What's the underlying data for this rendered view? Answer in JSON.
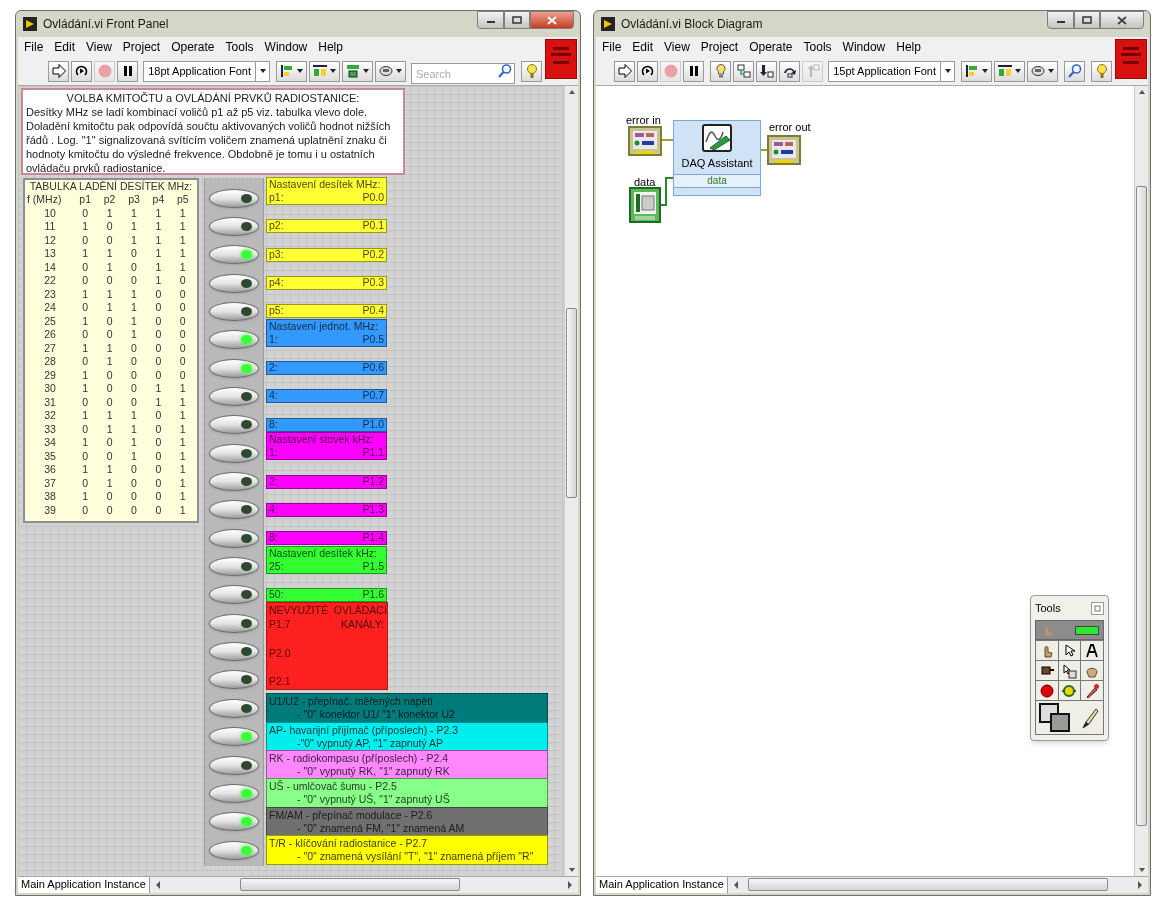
{
  "front_panel": {
    "title": "Ovládání.vi Front Panel",
    "active": true,
    "menu": [
      "File",
      "Edit",
      "View",
      "Project",
      "Operate",
      "Tools",
      "Window",
      "Help"
    ],
    "toolbar": [
      {
        "kind": "run",
        "disabled": false
      },
      {
        "kind": "run_continuous",
        "disabled": false
      },
      {
        "kind": "abort",
        "disabled": true
      },
      {
        "kind": "pause",
        "disabled": false
      },
      {
        "kind": "font",
        "value": "18pt Application Font",
        "disabled": false
      },
      {
        "kind": "align",
        "disabled": false
      },
      {
        "kind": "distribute",
        "disabled": false
      },
      {
        "kind": "resize",
        "disabled": false
      },
      {
        "kind": "reorder",
        "disabled": false
      },
      {
        "kind": "search",
        "placeholder": "Search",
        "disabled": false
      },
      {
        "kind": "help",
        "disabled": false
      }
    ],
    "note": {
      "title": "VOLBA KMITOČTU a OVLÁDÁNÍ PRVKŮ RADIOSTANICE:",
      "text": "Desítky MHz se ladí kombinací voličů p1 až p5 viz. tabulka vlevo dole.\nDoladění kmitočtu pak odpovídá součtu aktivovaných voličů hodnot nižších\nřádů . Log. \"1\" signalizovaná svítícím voličem znamená uplatnění znaku či\nhodnoty kmitočtu do výsledné frekvence. Obdobně je tomu i u ostatních\novládaču prvků radiostanice."
    },
    "table": {
      "title": "TABULKA LADĚNÍ DESÍTEK MHz:",
      "columns": [
        "f (MHz)",
        "p1",
        "p2",
        "p3",
        "p4",
        "p5"
      ],
      "rows": [
        [
          "10",
          "0",
          "1",
          "1",
          "1",
          "1"
        ],
        [
          "11",
          "1",
          "0",
          "1",
          "1",
          "1"
        ],
        [
          "12",
          "0",
          "0",
          "1",
          "1",
          "1"
        ],
        [
          "13",
          "1",
          "1",
          "0",
          "1",
          "1"
        ],
        [
          "14",
          "0",
          "1",
          "0",
          "1",
          "1"
        ],
        [
          "22",
          "0",
          "0",
          "0",
          "1",
          "0"
        ],
        [
          "23",
          "1",
          "1",
          "1",
          "0",
          "0"
        ],
        [
          "24",
          "0",
          "1",
          "1",
          "0",
          "0"
        ],
        [
          "25",
          "1",
          "0",
          "1",
          "0",
          "0"
        ],
        [
          "26",
          "0",
          "0",
          "1",
          "0",
          "0"
        ],
        [
          "27",
          "1",
          "1",
          "0",
          "0",
          "0"
        ],
        [
          "28",
          "0",
          "1",
          "0",
          "0",
          "0"
        ],
        [
          "29",
          "1",
          "0",
          "0",
          "0",
          "0"
        ],
        [
          "30",
          "1",
          "0",
          "0",
          "1",
          "1"
        ],
        [
          "31",
          "0",
          "0",
          "0",
          "1",
          "1"
        ],
        [
          "32",
          "1",
          "1",
          "1",
          "0",
          "1"
        ],
        [
          "33",
          "0",
          "1",
          "1",
          "0",
          "1"
        ],
        [
          "34",
          "1",
          "0",
          "1",
          "0",
          "1"
        ],
        [
          "35",
          "0",
          "0",
          "1",
          "0",
          "1"
        ],
        [
          "36",
          "1",
          "1",
          "0",
          "0",
          "1"
        ],
        [
          "37",
          "0",
          "1",
          "0",
          "0",
          "1"
        ],
        [
          "38",
          "1",
          "0",
          "0",
          "0",
          "1"
        ],
        [
          "39",
          "0",
          "0",
          "0",
          "0",
          "1"
        ]
      ]
    },
    "switches": [
      {
        "on": false
      },
      {
        "on": false
      },
      {
        "on": true
      },
      {
        "on": false
      },
      {
        "on": false
      },
      {
        "on": true
      },
      {
        "on": true
      },
      {
        "on": false
      },
      {
        "on": false
      },
      {
        "on": false
      },
      {
        "on": false
      },
      {
        "on": false
      },
      {
        "on": false
      },
      {
        "on": false
      },
      {
        "on": false
      },
      {
        "on": false
      },
      {
        "on": false
      },
      {
        "on": false
      },
      {
        "on": false
      },
      {
        "on": true
      },
      {
        "on": false
      },
      {
        "on": true
      },
      {
        "on": true
      },
      {
        "on": true
      }
    ],
    "label_groups": [
      {
        "kind": "pins",
        "color": "#ffff33",
        "header": "Nastavení desítek MHz:",
        "items": [
          {
            "name": "p1:",
            "pin": "P0.0"
          },
          {
            "name": "p2:",
            "pin": "P0.1"
          },
          {
            "name": "p3:",
            "pin": "P0.2"
          },
          {
            "name": "p4:",
            "pin": "P0.3"
          },
          {
            "name": "p5:",
            "pin": "P0.4"
          }
        ]
      },
      {
        "kind": "pins",
        "color": "#3399ff",
        "header": "Nastavení jednot. MHz:",
        "items": [
          {
            "name": "1:",
            "pin": "P0.5"
          },
          {
            "name": "2:",
            "pin": "P0.6"
          },
          {
            "name": "4:",
            "pin": "P0.7"
          },
          {
            "name": "8:",
            "pin": "P1.0"
          }
        ]
      },
      {
        "kind": "pins",
        "color": "#ff00ff",
        "header": "Nastavení stovek kHz:",
        "items": [
          {
            "name": "1:",
            "pin": "P1.1"
          },
          {
            "name": "2:",
            "pin": "P1.2"
          },
          {
            "name": "4:",
            "pin": "P1.3"
          },
          {
            "name": "8:",
            "pin": "P1.4"
          }
        ]
      },
      {
        "kind": "pins",
        "color": "#33ff33",
        "header": "Nastavení desítek kHz:",
        "items": [
          {
            "name": "25:",
            "pin": "P1.5"
          },
          {
            "name": "50:",
            "pin": "P1.6"
          }
        ]
      },
      {
        "kind": "block",
        "color": "#ff2020",
        "header": "NEVYUŽITÉ  OVLÁDACÍ",
        "header_end": "KANÁLY:",
        "items": [
          {
            "pin": "P1.7"
          },
          {
            "pin": "P2.0"
          },
          {
            "pin": "P2.1"
          }
        ]
      },
      {
        "kind": "note",
        "items": [
          {
            "color": "#007a7a",
            "title": "U1/U2 - přepínač. měřených napětí",
            "detail": "- \"0\" konektor U1/ \"1\" konektor U2"
          },
          {
            "color": "#00eeee",
            "title": "AP- havarijní přijímač (příposlech) - P2.3",
            "detail": "-\"0\" vypnutý AP, \"1\" zapnutý AP"
          },
          {
            "color": "#ff88ff",
            "title": "RK - radiokompasu (příposlech) - P2.4",
            "detail": "- \"0\" vypnutý RK, \"1\" zapnutý RK"
          },
          {
            "color": "#88ff88",
            "title": "UŠ - umlčovač šumu - P2.5",
            "detail": "- \"0\" vypnutý UŠ, \"1\" zapnutý UŠ"
          },
          {
            "color": "#707070",
            "title": "FM/AM - přepínač modulace - P2.6",
            "detail": "- \"0\" znamená FM, \"1\" znamená AM"
          },
          {
            "color": "#ffff00",
            "title": "T/R - klíčování radiostanice - P2.7",
            "detail": "- \"0\" znamená vysílání \"T\", \"1\" znamená příjem \"R\""
          }
        ]
      }
    ],
    "status_bar": "Main Application Instance"
  },
  "block_diagram": {
    "title": "Ovládání.vi Block Diagram",
    "active": false,
    "menu": [
      "File",
      "Edit",
      "View",
      "Project",
      "Operate",
      "Tools",
      "Window",
      "Help"
    ],
    "toolbar": [
      {
        "kind": "run",
        "disabled": false
      },
      {
        "kind": "run_continuous",
        "disabled": false
      },
      {
        "kind": "abort",
        "disabled": true
      },
      {
        "kind": "pause",
        "disabled": false
      },
      {
        "kind": "highlight",
        "disabled": false
      },
      {
        "kind": "retain",
        "disabled": false
      },
      {
        "kind": "step_into",
        "disabled": false
      },
      {
        "kind": "step_over",
        "disabled": false
      },
      {
        "kind": "step_out",
        "disabled": true
      },
      {
        "kind": "font",
        "value": "15pt Application Font",
        "disabled": false
      },
      {
        "kind": "align",
        "disabled": false
      },
      {
        "kind": "distribute",
        "disabled": false
      },
      {
        "kind": "reorder",
        "disabled": false
      },
      {
        "kind": "zoom",
        "disabled": false
      },
      {
        "kind": "help",
        "disabled": false
      }
    ],
    "diagram": {
      "error_in_label": "error in",
      "error_out_label": "error out",
      "express_vi": {
        "title": "DAQ Assistant",
        "input": "data"
      },
      "data_label": "data"
    },
    "status_bar": "Main Application Instance"
  },
  "tools_palette": {
    "title": "Tools",
    "auto_select": true
  }
}
